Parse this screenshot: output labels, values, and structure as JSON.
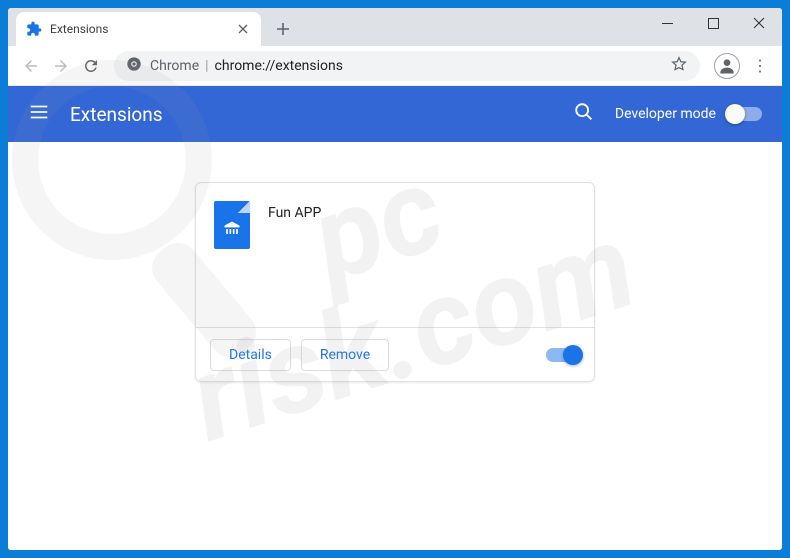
{
  "window": {
    "tab_title": "Extensions",
    "tab_icon": "puzzle-icon"
  },
  "omnibox": {
    "scheme_icon": "chrome-icon",
    "scheme_label": "Chrome",
    "url": "chrome://extensions"
  },
  "header": {
    "title": "Extensions",
    "developer_mode_label": "Developer mode",
    "developer_mode_enabled": false
  },
  "extension": {
    "name": "Fun APP",
    "icon": "android-apk-icon",
    "enabled": true,
    "actions": {
      "details": "Details",
      "remove": "Remove"
    }
  },
  "watermark": {
    "line1": "pc",
    "line2": "risk.com"
  }
}
